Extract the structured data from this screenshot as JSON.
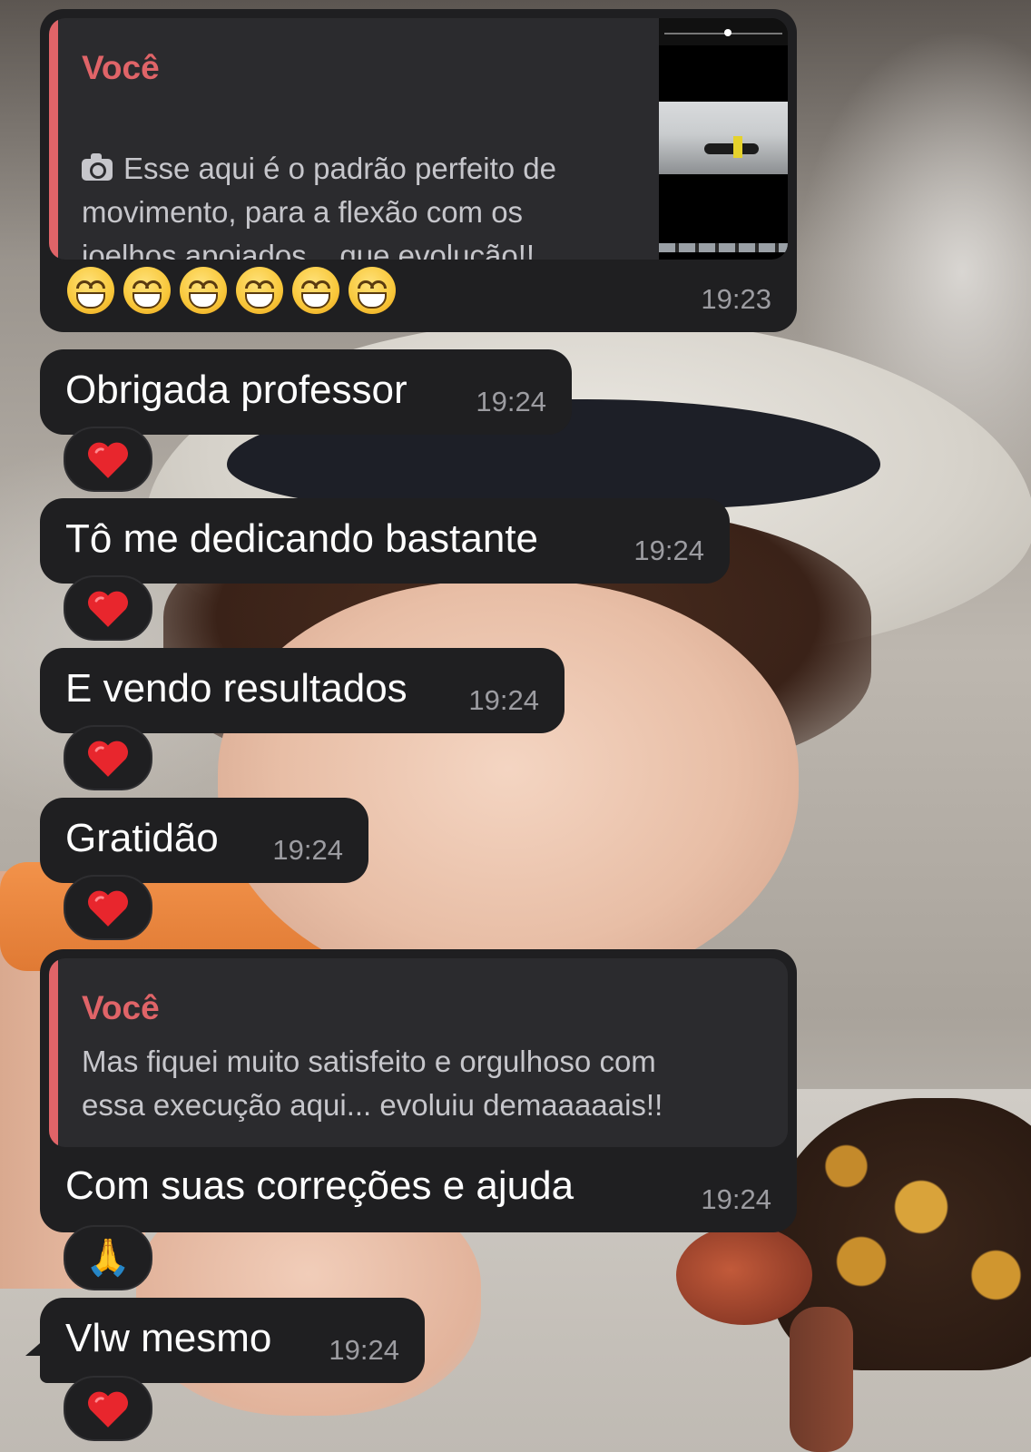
{
  "quoted_photo_message": {
    "author": "Você",
    "text": "Esse aqui é o padrão perfeito de\nmovimento, para a flexão com os\njoelhos apoiados... que evolução!!...",
    "emojis": [
      "😁",
      "😁",
      "😁",
      "😁",
      "😁",
      "😁"
    ],
    "time": "19:23"
  },
  "messages": [
    {
      "text": "Obrigada professor",
      "time": "19:24",
      "reaction": "❤️"
    },
    {
      "text": "Tô me dedicando bastante",
      "time": "19:24",
      "reaction": "❤️"
    },
    {
      "text": "E vendo resultados",
      "time": "19:24",
      "reaction": "❤️"
    },
    {
      "text": "Gratidão",
      "time": "19:24",
      "reaction": "❤️"
    }
  ],
  "quoted_reply_message": {
    "author": "Você",
    "quote": "Mas fiquei muito satisfeito e orgulhoso com\nessa execução aqui... evoluiu demaaaaais!!",
    "text": "Com suas correções e ajuda",
    "time": "19:24",
    "reaction": "🙏"
  },
  "last_message": {
    "text": "Vlw mesmo",
    "time": "19:24",
    "reaction": "❤️"
  },
  "colors": {
    "bubble": "#1f1f21",
    "quote_accent": "#e06468",
    "time_text": "#9c9ca1"
  }
}
